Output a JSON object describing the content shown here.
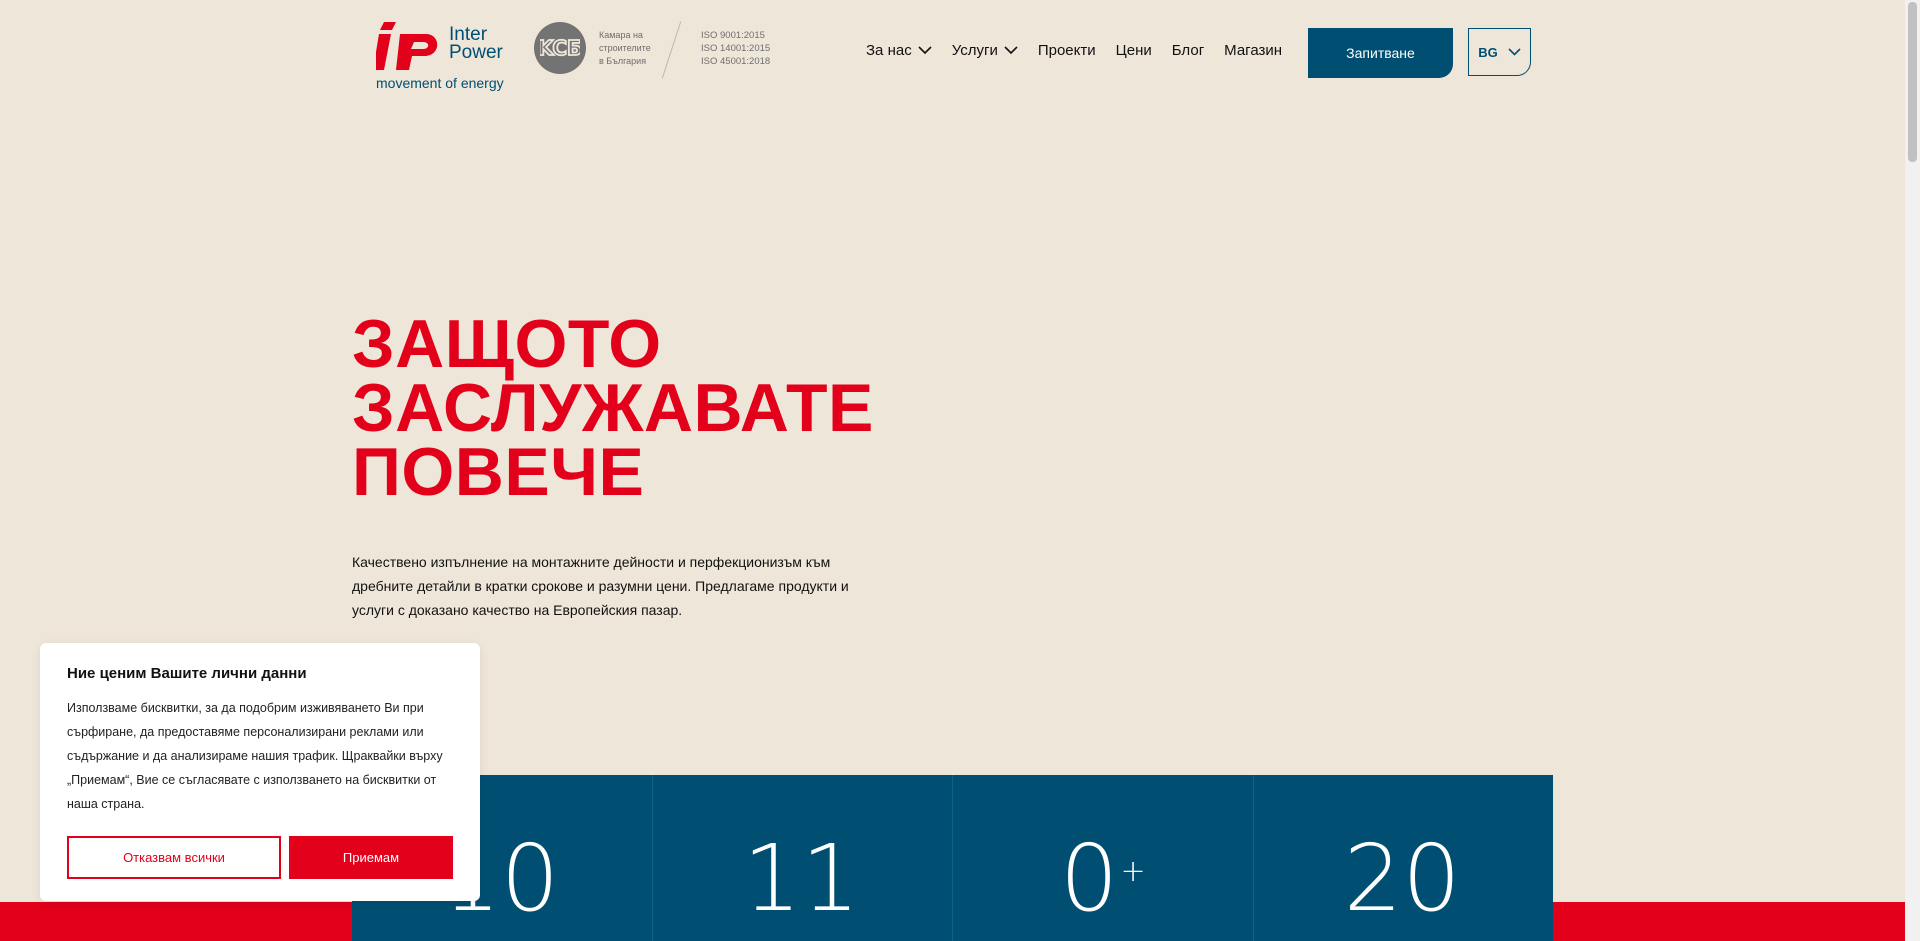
{
  "header": {
    "brand_name_line1": "Inter",
    "brand_name_line2": "Power",
    "brand_tagline": "movement of energy",
    "chamber_text": [
      "Камара на",
      "строителите",
      "в България"
    ],
    "iso_lines": [
      "ISO 9001:2015",
      "ISO 14001:2015",
      "ISO 45001:2018"
    ],
    "nav": [
      {
        "label": "За нас",
        "has_dropdown": true
      },
      {
        "label": "Услуги",
        "has_dropdown": true
      },
      {
        "label": "Проекти",
        "has_dropdown": false
      },
      {
        "label": "Цени",
        "has_dropdown": false
      },
      {
        "label": "Блог",
        "has_dropdown": false
      },
      {
        "label": "Магазин",
        "has_dropdown": false
      }
    ],
    "inquiry_label": "Запитване",
    "language": "BG"
  },
  "hero": {
    "title_lines": [
      "ЗАЩОТО",
      "ЗАСЛУЖАВАТЕ",
      "ПОВЕЧЕ"
    ],
    "text": "Качествено изпълнение на монтажните дейности и перфекционизъм към дребните детайли в кратки срокове и разумни цени. Предлагаме продукти и услуги с доказано качество на Европейския пазар."
  },
  "stats": [
    {
      "value": "10",
      "suffix": ""
    },
    {
      "value": "11",
      "suffix": ""
    },
    {
      "value": "0",
      "suffix": "+"
    },
    {
      "value": "20",
      "suffix": ""
    }
  ],
  "cookie": {
    "title": "Ние ценим Вашите лични данни",
    "text": "Използваме бисквитки, за да подобрим изживяването Ви при сърфиране, да предоставяме персонализирани реклами или съдържание и да анализираме нашия трафик. Щраквайки върху „Приемам“, Вие се съгласявате с използването на бисквитки от наша страна.",
    "reject_label": "Отказвам всички",
    "accept_label": "Приемам"
  },
  "colors": {
    "brand_red": "#e2001a",
    "brand_blue": "#004f72",
    "background": "#efe6da"
  }
}
